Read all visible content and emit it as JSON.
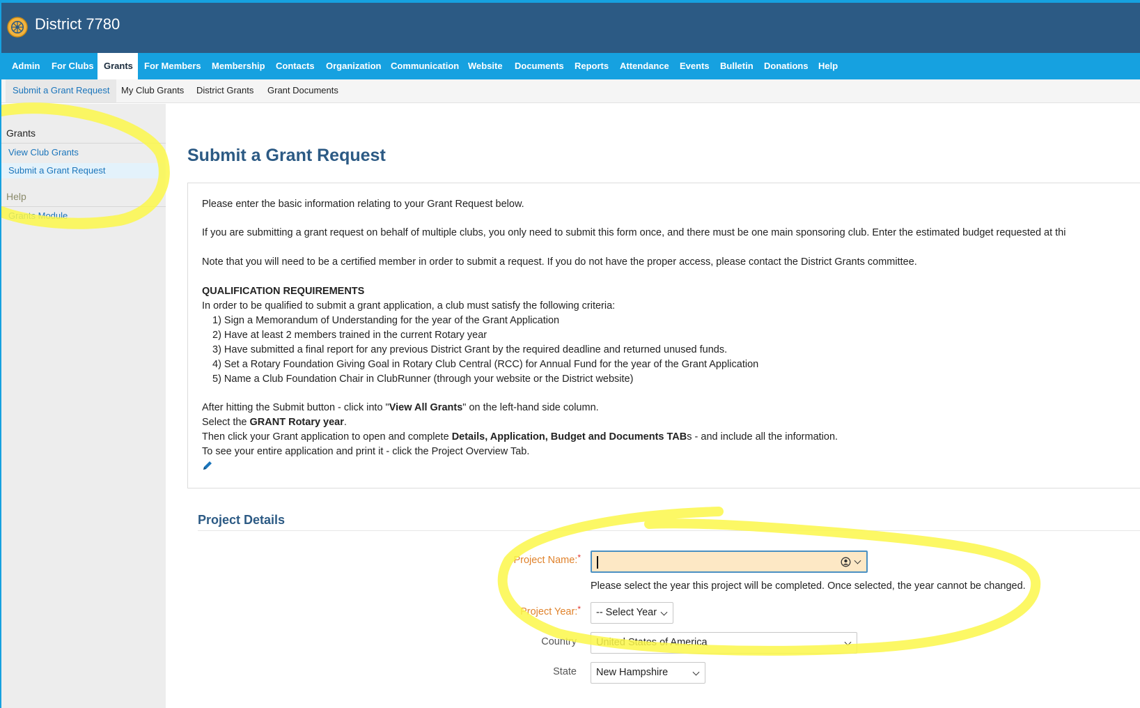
{
  "header": {
    "title": "District 7780"
  },
  "main_nav": {
    "items": [
      "Admin",
      "For Clubs",
      "Grants",
      "For Members",
      "Membership",
      "Contacts",
      "Organization",
      "Communication",
      "Website",
      "Documents",
      "Reports",
      "Attendance",
      "Events",
      "Bulletin",
      "Donations",
      "Help"
    ],
    "active": "Grants"
  },
  "sub_nav": {
    "items": [
      "Submit a Grant Request",
      "My Club Grants",
      "District Grants",
      "Grant Documents"
    ],
    "active": "Submit a Grant Request"
  },
  "sidebar": {
    "grants_heading": "Grants",
    "grants_links": [
      "View Club Grants",
      "Submit a Grant Request"
    ],
    "active_link": "Submit a Grant Request",
    "help_heading": "Help",
    "help_links": [
      "Grants Module"
    ]
  },
  "main": {
    "page_title": "Submit a Grant Request",
    "intro": {
      "p1": "Please enter the basic information relating to your Grant Request below.",
      "p2": "If you are submitting a grant request on behalf of multiple clubs, you only need to submit this form once, and there must be one main sponsoring club. Enter the estimated budget requested at thi",
      "p3": "Note that you will need to be a certified member in order to submit a request. If you do not have the proper access, please contact the District Grants committee.",
      "qual_heading": "QUALIFICATION REQUIREMENTS",
      "qual_intro": "In order to be qualified to submit a grant application, a club must satisfy the following criteria:",
      "criteria": [
        "1) Sign a Memorandum of Understanding for the year of the Grant Application",
        "2) Have at least 2 members trained in the current Rotary year",
        "3) Have submitted a final report for any previous District Grant by the required deadline and returned unused funds.",
        "4) Set a Rotary Foundation Giving Goal in Rotary Club Central (RCC) for Annual Fund for the year of the Grant Application",
        "5) Name a Club Foundation Chair in ClubRunner (through your website or the District website)"
      ],
      "after": {
        "l1_a": "After hitting the Submit button - click into \"",
        "l1_b": "View All Grants",
        "l1_c": "\" on the left-hand side column.",
        "l2_a": "Select the ",
        "l2_b": "GRANT Rotary year",
        "l2_c": ".",
        "l3_a": "Then click your Grant application to open and complete ",
        "l3_b": "Details, Application, Budget and Documents TAB",
        "l3_c": "s - and include all the information.",
        "l4": "To see your entire application and print it - click the Project Overview Tab."
      },
      "edit_icon": "pencil-icon"
    },
    "section_title": "Project Details",
    "form": {
      "project_name_label": "Project Name:",
      "project_name_value": "",
      "project_year_help": "Please select the year this project will be completed. Once selected, the year cannot be changed.",
      "project_year_label": "Project Year:",
      "project_year_value": "-- Select Year",
      "country_label": "Country",
      "country_value": "United States of America",
      "state_label": "State",
      "state_value": "New Hampshire",
      "required_mark": "*"
    }
  },
  "colors": {
    "header_bg": "#2c5a84",
    "nav_bg": "#16a1e0",
    "link": "#1b75bb",
    "required_label": "#e0822b",
    "focused_input_bg": "#fde8c5",
    "highlighter": "#fbf74a"
  }
}
